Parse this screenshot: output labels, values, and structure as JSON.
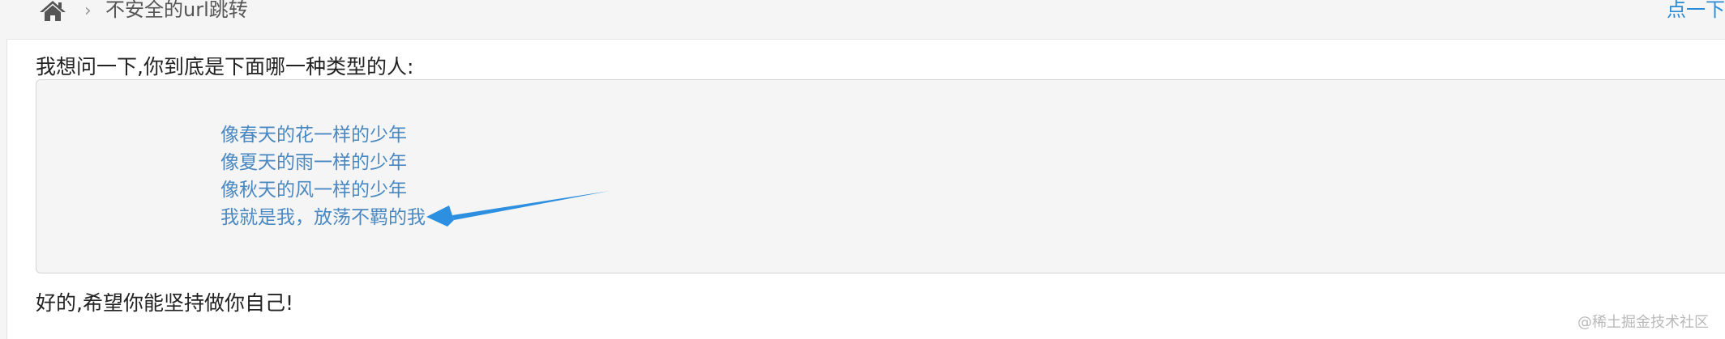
{
  "breadcrumb": {
    "home_icon": "home-icon",
    "separator": "›",
    "current": "不安全的url跳转"
  },
  "header": {
    "right_link": "点一下"
  },
  "main": {
    "question": "我想问一下,你到底是下面哪一种类型的人:",
    "options": [
      {
        "label": "像春天的花一样的少年"
      },
      {
        "label": "像夏天的雨一样的少年"
      },
      {
        "label": "像秋天的风一样的少年"
      },
      {
        "label": "我就是我，放荡不羁的我"
      }
    ],
    "reply": "好的,希望你能坚持做你自己!"
  },
  "watermark": "@稀土掘金技术社区",
  "colors": {
    "link": "#4a88c2",
    "annotation_arrow": "#2d8fe0",
    "panel_bg": "#f5f5f5",
    "header_bg": "#f5f5f5"
  }
}
